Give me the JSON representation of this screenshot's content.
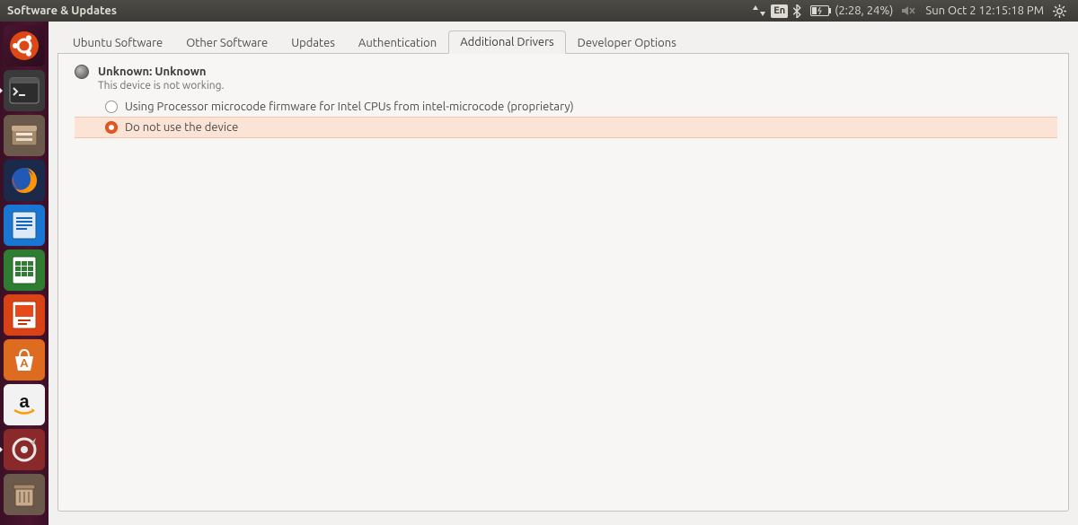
{
  "menubar": {
    "title": "Software & Updates",
    "network_icon": "network-transmit-receive",
    "input": "En",
    "bluetooth_icon": "bluetooth",
    "battery_icon": "battery-charging",
    "battery_text": "(2:28, 24%)",
    "volume_icon": "volume-muted",
    "datetime": "Sun Oct  2 12:15:18 PM",
    "session_icon": "session-gear"
  },
  "launcher": {
    "items": [
      {
        "name": "dash",
        "title": "Dash"
      },
      {
        "name": "terminal",
        "title": "Terminal"
      },
      {
        "name": "files",
        "title": "Files"
      },
      {
        "name": "firefox",
        "title": "Firefox"
      },
      {
        "name": "writer",
        "title": "LibreOffice Writer"
      },
      {
        "name": "calc",
        "title": "LibreOffice Calc"
      },
      {
        "name": "impress",
        "title": "LibreOffice Impress"
      },
      {
        "name": "software",
        "title": "Ubuntu Software"
      },
      {
        "name": "amazon",
        "title": "Amazon"
      },
      {
        "name": "settings",
        "title": "System Settings"
      },
      {
        "name": "trash",
        "title": "Trash"
      }
    ]
  },
  "tabs": [
    {
      "label": "Ubuntu Software",
      "active": false
    },
    {
      "label": "Other Software",
      "active": false
    },
    {
      "label": "Updates",
      "active": false
    },
    {
      "label": "Authentication",
      "active": false
    },
    {
      "label": "Additional Drivers",
      "active": true
    },
    {
      "label": "Developer Options",
      "active": false
    }
  ],
  "drivers": {
    "device_title": "Unknown: Unknown",
    "device_sub": "This device is not working.",
    "options": [
      {
        "label": "Using Processor microcode firmware for Intel CPUs from intel-microcode (proprietary)",
        "selected": false
      },
      {
        "label": "Do not use the device",
        "selected": true
      }
    ]
  }
}
